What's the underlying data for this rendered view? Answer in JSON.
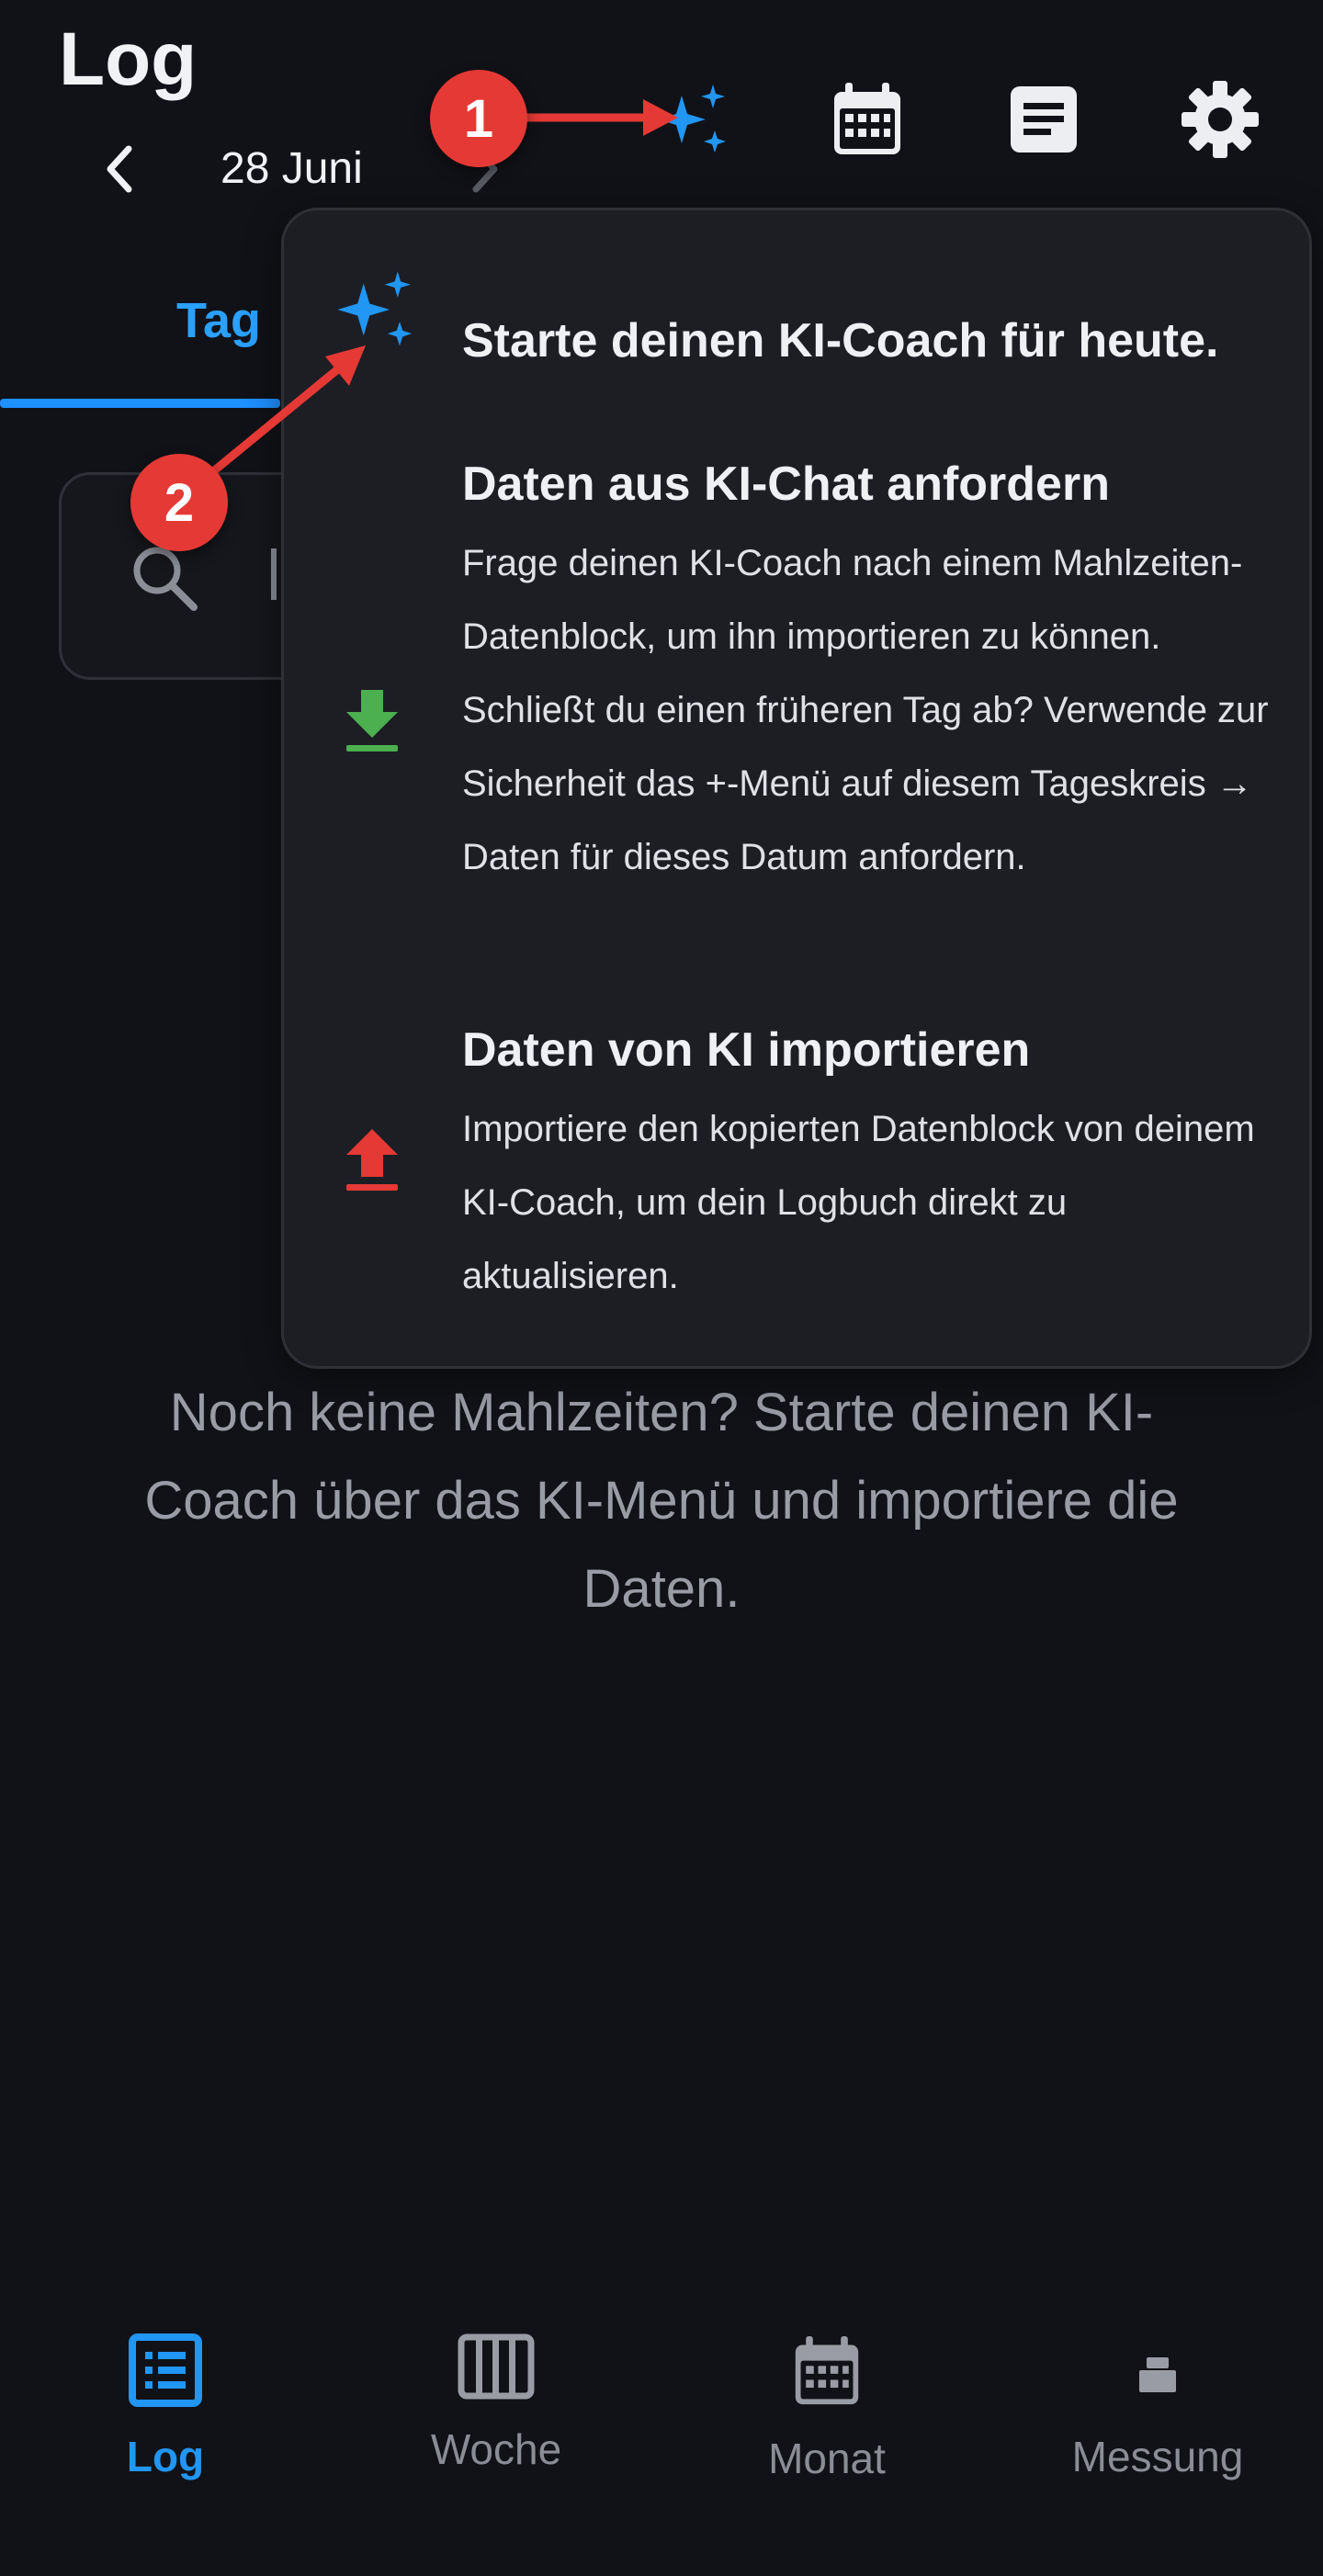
{
  "header": {
    "title": "Log",
    "date": "28 Juni",
    "icons": [
      "ai-sparkle-icon",
      "calendar-icon",
      "notes-icon",
      "settings-icon"
    ]
  },
  "tabs": {
    "active": "Tag"
  },
  "popover": {
    "coach_title": "Starte deinen KI-Coach für heute.",
    "request_title": "Daten aus KI-Chat anfordern",
    "request_body": "Frage deinen KI-Coach nach einem Mahlzeiten-Datenblock, um ihn importieren zu können. Schließt du einen früheren Tag ab? Verwende zur Sicherheit das +-Menü auf diesem Tageskreis → Daten für dieses Datum anfordern.",
    "import_title": "Daten von KI importieren",
    "import_body": "Importiere den kopierten Datenblock von deinem KI-Coach, um dein Logbuch direkt zu aktualisieren."
  },
  "empty_state": "Noch keine Mahlzeiten? Starte deinen KI-Coach über das KI-Menü und importiere die Daten.",
  "annotations": {
    "badge1": "1",
    "badge2": "2"
  },
  "bottom_nav": {
    "log": "Log",
    "week": "Woche",
    "month": "Monat",
    "measure": "Messung"
  },
  "colors": {
    "accent": "#1e90ff",
    "download": "#4caf50",
    "upload": "#e53935",
    "badge": "#e53935"
  }
}
